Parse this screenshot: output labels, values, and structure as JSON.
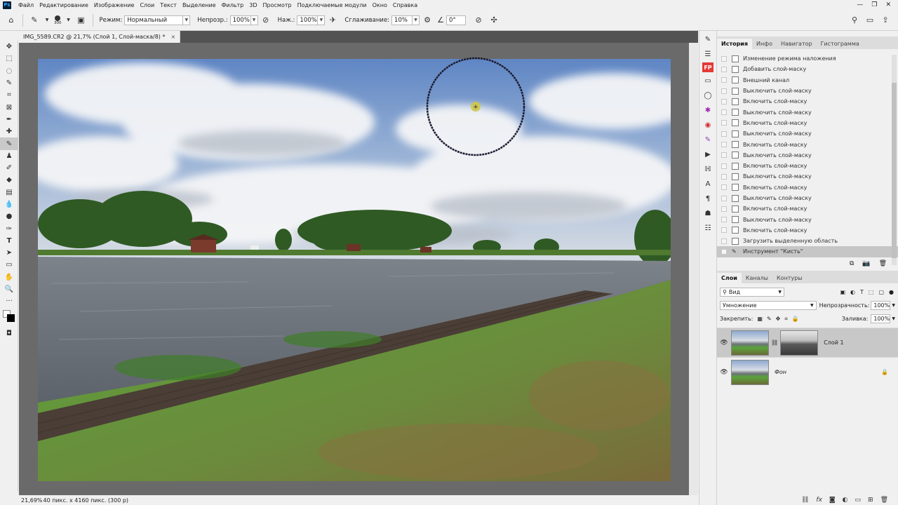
{
  "menu": {
    "items": [
      "Файл",
      "Редактирование",
      "Изображение",
      "Слои",
      "Текст",
      "Выделение",
      "Фильтр",
      "3D",
      "Просмотр",
      "Подключаемые модули",
      "Окно",
      "Справка"
    ]
  },
  "options": {
    "brush_size": "300",
    "mode_label": "Режим:",
    "mode_value": "Нормальный",
    "opacity_label": "Непрозр.:",
    "opacity_value": "100%",
    "pressure_label": "Наж.:",
    "pressure_value": "100%",
    "smoothing_label": "Сглаживание:",
    "smoothing_value": "10%",
    "angle_value": "0°"
  },
  "document": {
    "tab_title": "IMG_5589.CR2 @ 21,7% (Слой 1, Слой-маска/8) *",
    "status": "21,69%",
    "status_dims": "40 пикс. x 4160 пикс. (300 p)"
  },
  "history": {
    "tabs": [
      "История",
      "Инфо",
      "Навигатор",
      "Гистограмма"
    ],
    "items": [
      "Изменение режима наложения",
      "Добавить слой-маску",
      "Внешний канал",
      "Выключить слой-маску",
      "Включить слой-маску",
      "Выключить слой-маску",
      "Включить слой-маску",
      "Выключить слой-маску",
      "Включить слой-маску",
      "Выключить слой-маску",
      "Включить слой-маску",
      "Выключить слой-маску",
      "Включить слой-маску",
      "Выключить слой-маску",
      "Включить слой-маску",
      "Выключить слой-маску",
      "Включить слой-маску",
      "Загрузить выделенную область",
      "Инструмент \"Кисть\""
    ]
  },
  "layers_panel": {
    "tabs": [
      "Слои",
      "Каналы",
      "Контуры"
    ],
    "filter": "Вид",
    "blend_mode": "Умножение",
    "opacity_label": "Непрозрачность:",
    "opacity_value": "100%",
    "lock_label": "Закрепить:",
    "fill_label": "Заливка:",
    "fill_value": "100%",
    "layers": [
      {
        "name": "Слой 1"
      },
      {
        "name": "Фон"
      }
    ]
  },
  "iconstrip_fp": "FP",
  "colors": {
    "brush_cursor": "#1a1a2e",
    "history_selected": "#c6c6c6",
    "layer_selected": "#c8c8c8"
  }
}
